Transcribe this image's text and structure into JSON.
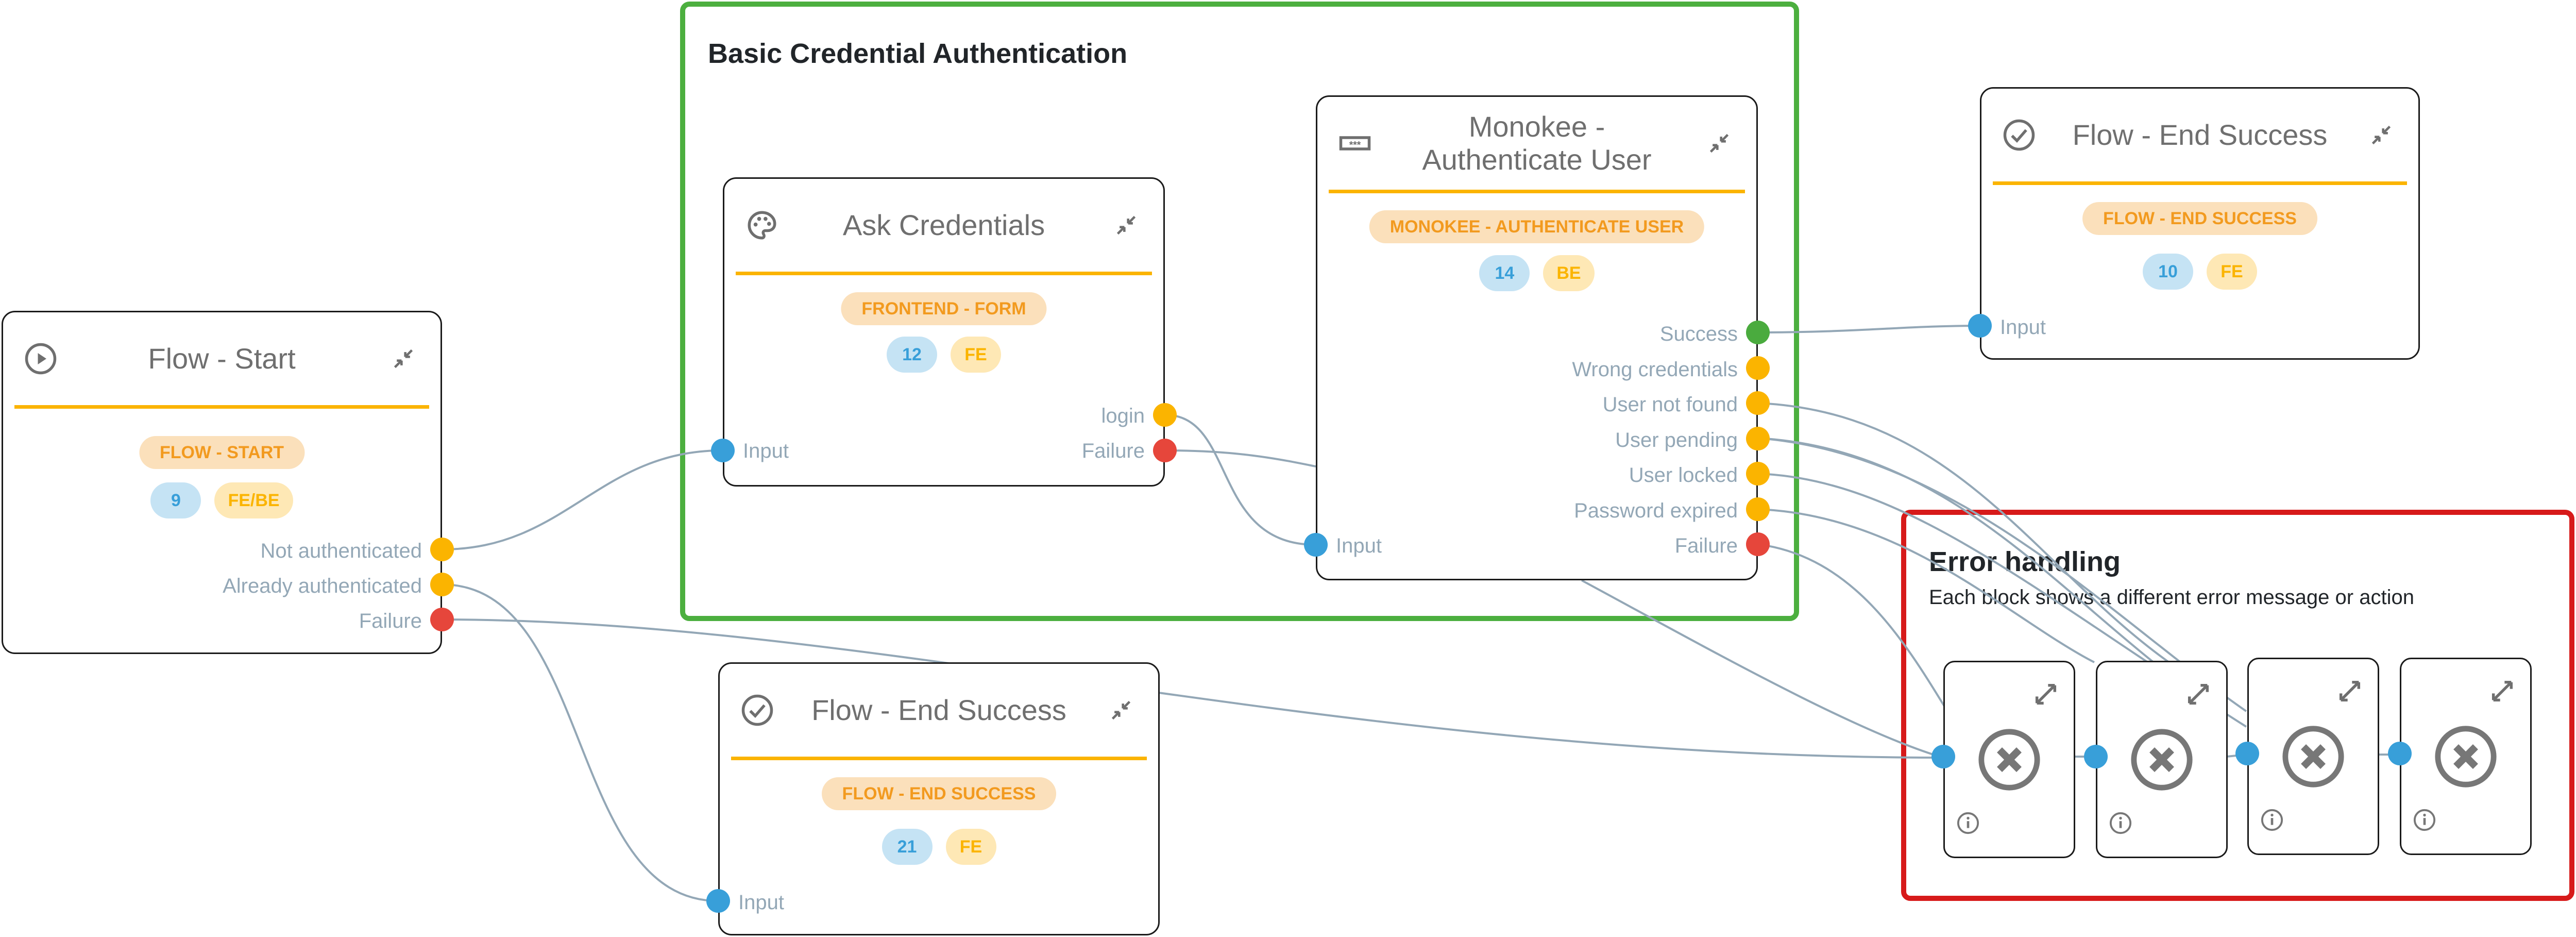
{
  "groups": {
    "auth": {
      "title": "Basic Credential Authentication",
      "border_color": "#4caf3f"
    },
    "errors": {
      "title": "Error handling",
      "subtitle": "Each block shows a different error message or action",
      "border_color": "#d71a1a"
    }
  },
  "nodes": {
    "flow_start": {
      "title": "Flow - Start",
      "icon": "play-circle-icon",
      "type_label": "FLOW - START",
      "id_badge": "9",
      "env_badge": "FE/BE",
      "outputs": [
        {
          "label": "Not authenticated",
          "kind": "warning"
        },
        {
          "label": "Already authenticated",
          "kind": "warning"
        },
        {
          "label": "Failure",
          "kind": "error"
        }
      ]
    },
    "ask_credentials": {
      "title": "Ask Credentials",
      "icon": "palette-icon",
      "type_label": "FRONTEND - FORM",
      "id_badge": "12",
      "env_badge": "FE",
      "input_label": "Input",
      "outputs": [
        {
          "label": "login",
          "kind": "warning"
        },
        {
          "label": "Failure",
          "kind": "error"
        }
      ]
    },
    "monokee_auth": {
      "title_line1": "Monokee -",
      "title_line2": "Authenticate User",
      "icon": "password-icon",
      "type_label": "MONOKEE - AUTHENTICATE USER",
      "id_badge": "14",
      "env_badge": "BE",
      "input_label": "Input",
      "outputs": [
        {
          "label": "Success",
          "kind": "success"
        },
        {
          "label": "Wrong credentials",
          "kind": "warning"
        },
        {
          "label": "User not found",
          "kind": "warning"
        },
        {
          "label": "User pending",
          "kind": "warning"
        },
        {
          "label": "User locked",
          "kind": "warning"
        },
        {
          "label": "Password expired",
          "kind": "warning"
        },
        {
          "label": "Failure",
          "kind": "error"
        }
      ]
    },
    "end_success_top": {
      "title": "Flow - End Success",
      "icon": "check-circle-icon",
      "type_label": "FLOW - END SUCCESS",
      "id_badge": "10",
      "env_badge": "FE",
      "input_label": "Input"
    },
    "end_success_bottom": {
      "title": "Flow - End Success",
      "icon": "check-circle-icon",
      "type_label": "FLOW - END SUCCESS",
      "id_badge": "21",
      "env_badge": "FE",
      "input_label": "Input"
    },
    "error_blocks": [
      {
        "icon": "close-circle-icon"
      },
      {
        "icon": "close-circle-icon"
      },
      {
        "icon": "close-circle-icon"
      },
      {
        "icon": "close-circle-icon"
      }
    ]
  },
  "connections": [
    {
      "from": "flow_start.Not authenticated",
      "to": "ask_credentials.Input"
    },
    {
      "from": "flow_start.Already authenticated",
      "to": "end_success_bottom.Input"
    },
    {
      "from": "flow_start.Failure",
      "to": "error_block_1.Input"
    },
    {
      "from": "ask_credentials.login",
      "to": "monokee_auth.Input"
    },
    {
      "from": "ask_credentials.Failure",
      "to": "error_block_1.Input"
    },
    {
      "from": "monokee_auth.Success",
      "to": "end_success_top.Input"
    },
    {
      "from": "monokee_auth.User not found",
      "to": "error_block_2"
    },
    {
      "from": "monokee_auth.User pending",
      "to": "error_block_2"
    },
    {
      "from": "monokee_auth.User locked",
      "to": "error_block_2"
    },
    {
      "from": "monokee_auth.Password expired",
      "to": "error_block_2"
    },
    {
      "from": "monokee_auth.Failure",
      "to": "error_block_1"
    }
  ],
  "colors": {
    "accent_divider": "#fbb400",
    "port_input": "#389fd9",
    "port_warning": "#fbb400",
    "port_success": "#4aab3e",
    "port_error": "#e6463b",
    "edge": "#93a7b6"
  }
}
